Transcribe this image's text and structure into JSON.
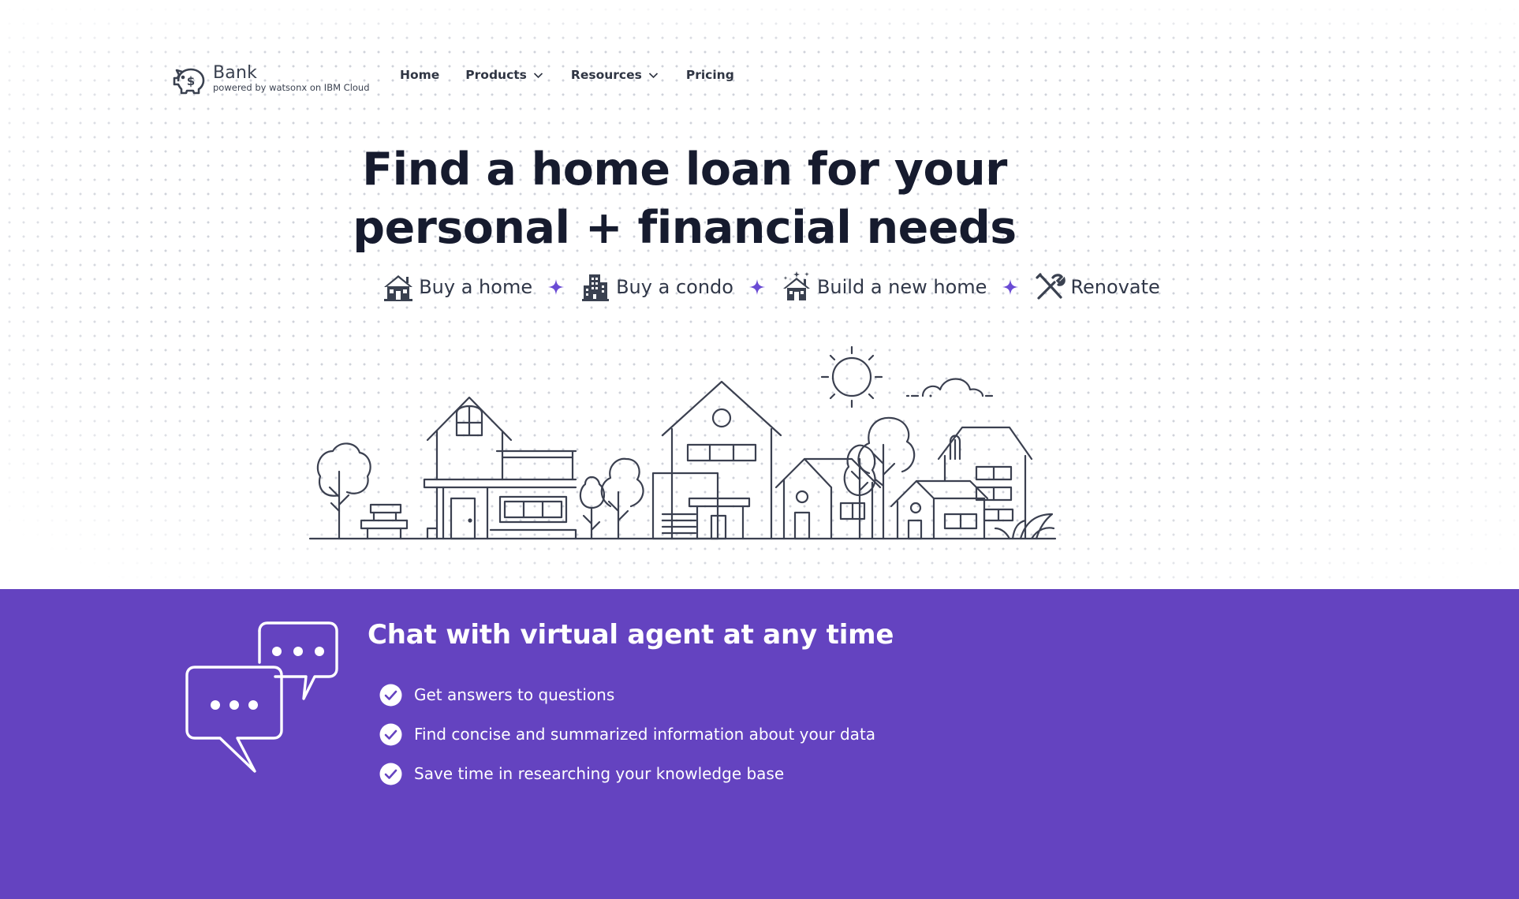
{
  "header": {
    "brand": "Bank",
    "tagline": "powered by watsonx on IBM Cloud",
    "logo_icon": "piggy-bank-icon",
    "nav": [
      {
        "label": "Home",
        "has_dropdown": false
      },
      {
        "label": "Products",
        "has_dropdown": true
      },
      {
        "label": "Resources",
        "has_dropdown": true
      },
      {
        "label": "Pricing",
        "has_dropdown": false
      }
    ]
  },
  "hero": {
    "headline_line1": "Find a home loan for your",
    "headline_line2": "personal + financial needs",
    "categories": [
      {
        "label": "Buy a home",
        "icon": "house-icon"
      },
      {
        "label": "Buy a condo",
        "icon": "condo-building-icon"
      },
      {
        "label": "Build a new home",
        "icon": "new-home-icon"
      },
      {
        "label": "Renovate",
        "icon": "tools-icon"
      }
    ],
    "separator_icon": "sparkle-icon",
    "illustration": "neighborhood-illustration"
  },
  "chat_section": {
    "title": "Chat with virtual agent at any time",
    "illustration": "chat-bubbles-icon",
    "features": [
      "Get answers to questions",
      "Find concise and summarized information about your data",
      "Save time in researching your knowledge base"
    ]
  },
  "colors": {
    "accent_purple": "#6443c0",
    "sparkle": "#6a4bd4",
    "text_dark": "#161b2e",
    "line_art": "#3b4050"
  }
}
